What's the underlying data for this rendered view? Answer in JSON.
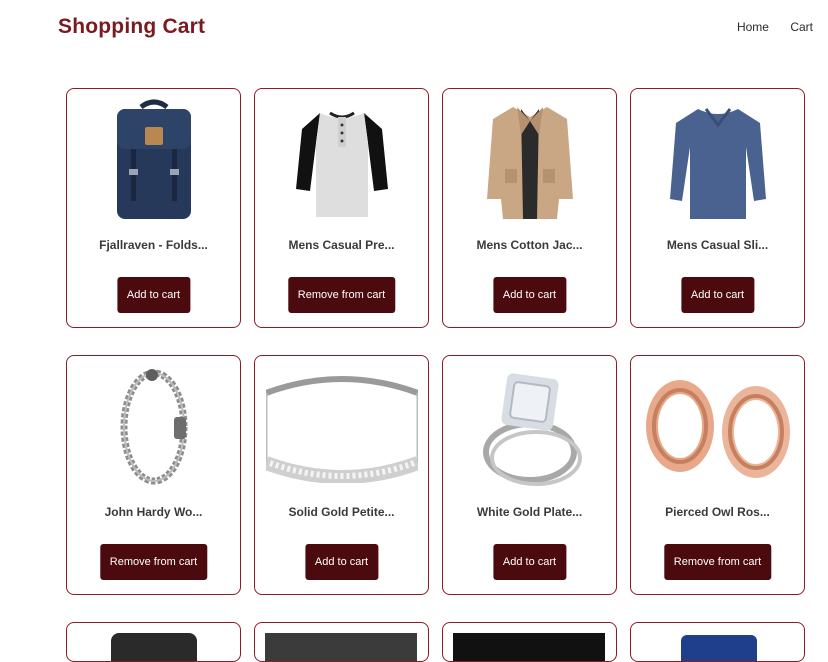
{
  "header": {
    "title": "Shopping Cart",
    "nav": [
      "Home",
      "Cart"
    ]
  },
  "products": [
    {
      "name": "Fjallraven - Folds...",
      "action": "Add to cart",
      "image_icon": "backpack-icon"
    },
    {
      "name": "Mens Casual Pre...",
      "action": "Remove from cart",
      "image_icon": "raglan-shirt-icon"
    },
    {
      "name": "Mens Cotton Jac...",
      "action": "Add to cart",
      "image_icon": "jacket-icon"
    },
    {
      "name": "Mens Casual Sli...",
      "action": "Add to cart",
      "image_icon": "long-sleeve-shirt-icon"
    },
    {
      "name": "John Hardy Wo...",
      "action": "Remove from cart",
      "image_icon": "bracelet-icon"
    },
    {
      "name": "Solid Gold Petite...",
      "action": "Add to cart",
      "image_icon": "ring-band-icon"
    },
    {
      "name": "White Gold Plate...",
      "action": "Add to cart",
      "image_icon": "diamond-ring-icon"
    },
    {
      "name": "Pierced Owl Ros...",
      "action": "Remove from cart",
      "image_icon": "tunnel-plugs-icon"
    }
  ],
  "colors": {
    "title": "#7a1a1f",
    "button": "#4b0a0e",
    "border": "#8a1c24"
  }
}
